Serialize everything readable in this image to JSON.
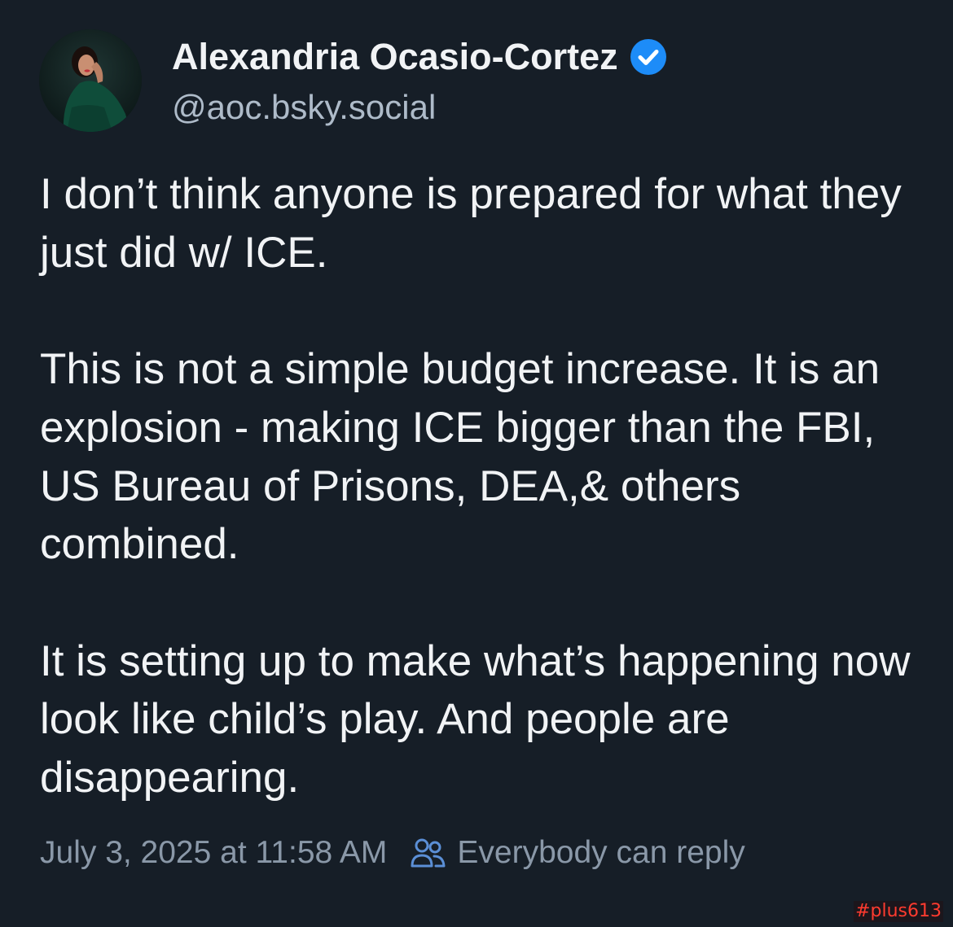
{
  "author": {
    "name": "Alexandria Ocasio-Cortez",
    "handle": "@aoc.bsky.social",
    "verified_icon": "verified-check-icon",
    "avatar_icon": "profile-photo"
  },
  "post": {
    "paragraphs": [
      "I don’t think anyone is prepared for what they just did w/ ICE.",
      "This is not a simple budget increase. It is an explosion - making ICE bigger than the FBI, US Bureau of Prisons, DEA,& others combined.",
      "It is setting up to make what’s happening now look like child’s play. And people are disappearing."
    ]
  },
  "meta": {
    "timestamp": "July 3, 2025 at 11:58 AM",
    "reply_setting": "Everybody can reply",
    "reply_icon": "users-icon"
  },
  "watermark": "#plus613",
  "colors": {
    "background": "#161e27",
    "text": "#f1f3f5",
    "muted": "#8a98a8",
    "handle": "#aebbc9",
    "verified": "#1d8cf8",
    "watermark": "#ff3b2f"
  }
}
